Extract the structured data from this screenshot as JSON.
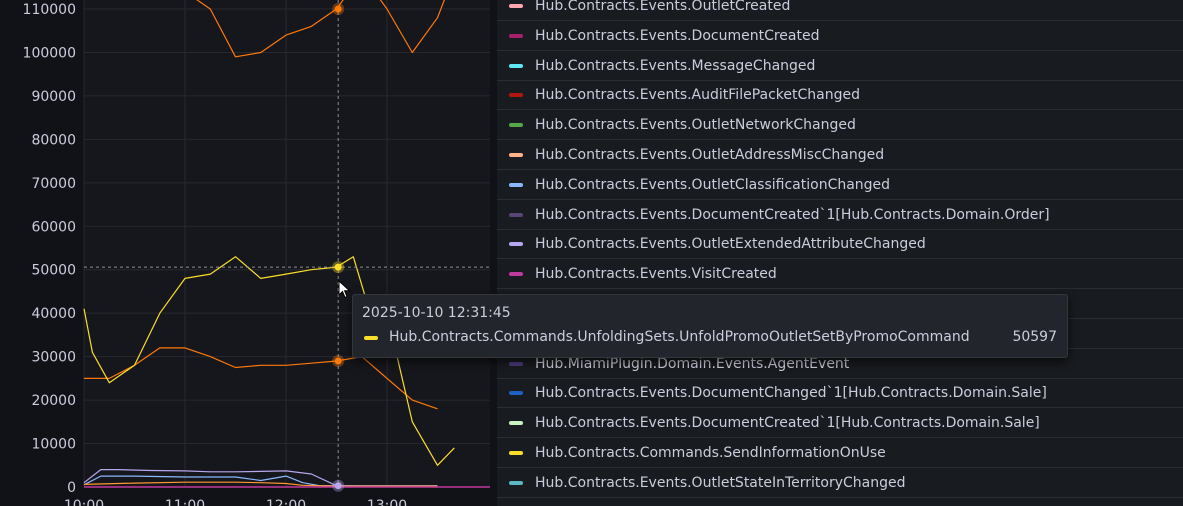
{
  "chart_data": {
    "type": "line",
    "ylim": [
      0,
      115000
    ],
    "y_ticks": [
      0,
      10000,
      20000,
      30000,
      40000,
      50000,
      60000,
      70000,
      80000,
      90000,
      100000,
      110000
    ],
    "y_tick_labels": [
      "0",
      "10000",
      "20000",
      "30000",
      "40000",
      "50000",
      "60000",
      "70000",
      "80000",
      "90000",
      "100000",
      "110000"
    ],
    "x_ticks": [
      "10:00",
      "11:00",
      "12:00",
      "13:00"
    ],
    "grid": true,
    "legend_placement": "right",
    "series": [
      {
        "color": "#ff780a",
        "x": [
          "10:00",
          "10:15",
          "10:30",
          "10:45",
          "11:00",
          "11:15",
          "11:30",
          "11:45",
          "12:00",
          "12:15",
          "12:30",
          "12:45",
          "13:00",
          "13:15",
          "13:30"
        ],
        "values": [
          25000,
          25000,
          28000,
          32000,
          32000,
          30000,
          27500,
          28000,
          28000,
          28500,
          29000,
          30000,
          25000,
          20000,
          18000
        ]
      },
      {
        "color": "#ff780a",
        "x": [
          "10:55",
          "11:00",
          "11:15",
          "11:30",
          "11:45",
          "12:00",
          "12:15",
          "12:30",
          "12:45",
          "13:00",
          "13:15",
          "13:30",
          "13:40"
        ],
        "values": [
          120000,
          114000,
          110000,
          99000,
          100000,
          104000,
          106000,
          110000,
          118000,
          110000,
          100000,
          108000,
          118000
        ]
      },
      {
        "color": "#fade2a",
        "x": [
          "10:00",
          "10:05",
          "10:15",
          "10:30",
          "10:45",
          "11:00",
          "11:15",
          "11:30",
          "11:45",
          "12:00",
          "12:15",
          "12:30",
          "12:40",
          "12:50",
          "13:00",
          "13:15",
          "13:30",
          "13:40"
        ],
        "values": [
          41000,
          31000,
          24000,
          28000,
          40000,
          48000,
          49000,
          53000,
          48000,
          49000,
          50000,
          50597,
          53000,
          40000,
          40000,
          15000,
          5000,
          9000
        ]
      },
      {
        "color": "#b7a7ef",
        "x": [
          "10:00",
          "10:10",
          "10:20",
          "10:40",
          "11:00",
          "11:15",
          "11:30",
          "11:45",
          "12:00",
          "12:15",
          "12:30",
          "12:45",
          "13:00",
          "13:30"
        ],
        "values": [
          1000,
          4000,
          4000,
          3800,
          3700,
          3500,
          3500,
          3600,
          3700,
          3000,
          300,
          200,
          200,
          200
        ]
      },
      {
        "color": "#8ab8ff",
        "x": [
          "10:00",
          "10:10",
          "10:30",
          "11:00",
          "11:30",
          "11:45",
          "12:00",
          "12:10",
          "12:20",
          "13:00",
          "13:30"
        ],
        "values": [
          500,
          2500,
          2500,
          2300,
          2300,
          1500,
          2500,
          1000,
          300,
          300,
          300
        ]
      },
      {
        "color": "#ff9830",
        "x": [
          "10:00",
          "10:30",
          "11:00",
          "11:30",
          "11:45",
          "12:00",
          "12:10",
          "12:30",
          "13:30"
        ],
        "values": [
          600,
          900,
          1100,
          1100,
          1000,
          800,
          400,
          200,
          200
        ]
      }
    ],
    "tooltip": {
      "time": "2025-10-10 12:31:45",
      "series": "Hub.Contracts.Commands.UnfoldingSets.UnfoldPromoOutletSetByPromoCommand",
      "value": "50597",
      "color": "#fade2a"
    },
    "legend": [
      {
        "label": "Hub.Contracts.Events.OutletCreated",
        "color": "#ffa6b0"
      },
      {
        "label": "Hub.Contracts.Events.DocumentCreated",
        "color": "#a6206a"
      },
      {
        "label": "Hub.Contracts.Events.MessageChanged",
        "color": "#5ee7f7"
      },
      {
        "label": "Hub.Contracts.Events.AuditFilePacketChanged",
        "color": "#b3160f"
      },
      {
        "label": "Hub.Contracts.Events.OutletNetworkChanged",
        "color": "#56a64b"
      },
      {
        "label": "Hub.Contracts.Events.OutletAddressMiscChanged",
        "color": "#ffb38a"
      },
      {
        "label": "Hub.Contracts.Events.OutletClassificationChanged",
        "color": "#8ab8ff"
      },
      {
        "label": "Hub.Contracts.Events.DocumentCreated`1[Hub.Contracts.Domain.Order]",
        "color": "#584477"
      },
      {
        "label": "Hub.Contracts.Events.OutletExtendedAttributeChanged",
        "color": "#b7a7ef"
      },
      {
        "label": "Hub.Contracts.Events.VisitCreated",
        "color": "#c0399e"
      },
      {
        "label": "",
        "color": "#6d1f62"
      },
      {
        "label": "",
        "color": "#806eb7"
      },
      {
        "label": "Hub.MiamiPlugin.Domain.Events.AgentEvent",
        "color": "#4b3a7a"
      },
      {
        "label": "Hub.Contracts.Events.DocumentChanged`1[Hub.Contracts.Domain.Sale]",
        "color": "#1f60c4"
      },
      {
        "label": "Hub.Contracts.Events.DocumentCreated`1[Hub.Contracts.Domain.Sale]",
        "color": "#c8f2c2"
      },
      {
        "label": "Hub.Contracts.Commands.SendInformationOnUse",
        "color": "#fade2a"
      },
      {
        "label": "Hub.Contracts.Events.OutletStateInTerritoryChanged",
        "color": "#5ab7c4"
      }
    ]
  }
}
